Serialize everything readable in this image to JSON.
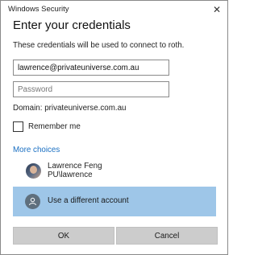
{
  "window": {
    "title": "Windows Security",
    "close_glyph": "✕"
  },
  "heading": "Enter your credentials",
  "description": "These credentials will be used to connect to roth.",
  "username": {
    "value": "lawrence@privateuniverse.com.au",
    "placeholder": ""
  },
  "password": {
    "value": "",
    "placeholder": "Password"
  },
  "domain_text": "Domain: privateuniverse.com.au",
  "remember": {
    "label": "Remember me",
    "checked": false
  },
  "more_choices": "More choices",
  "account": {
    "name": "Lawrence Feng",
    "id": "PU\\lawrence",
    "icon": "user-avatar-icon"
  },
  "different_account": {
    "label": "Use a different account",
    "icon": "person-icon",
    "selected_color": "#9ec6e8"
  },
  "buttons": {
    "ok": "OK",
    "cancel": "Cancel"
  }
}
